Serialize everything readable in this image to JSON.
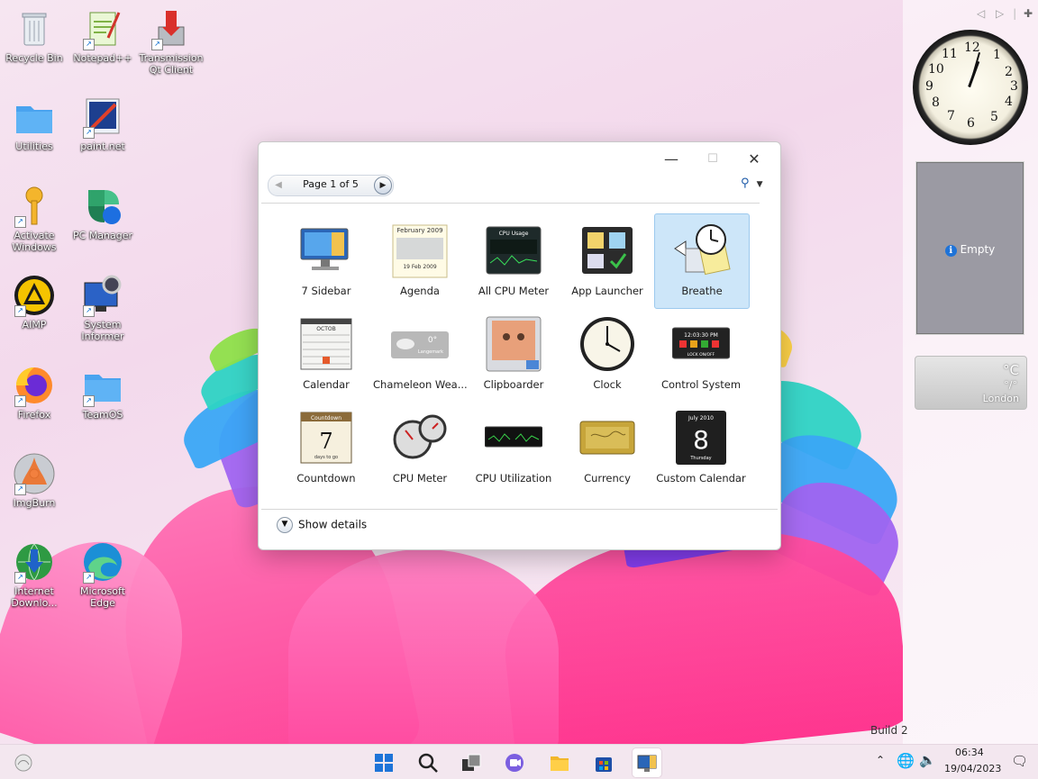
{
  "desktop": {
    "icons": [
      {
        "label": "Recycle Bin",
        "icon": "recycle-bin-icon"
      },
      {
        "label": "Notepad++",
        "icon": "notepad-plus-plus-icon"
      },
      {
        "label": "Transmission Qt Client",
        "icon": "transmission-icon"
      },
      {
        "label": "Utilities",
        "icon": "folder-icon"
      },
      {
        "label": "paint.net",
        "icon": "paint-net-icon"
      },
      {
        "label": "Activate Windows",
        "icon": "key-icon"
      },
      {
        "label": "PC Manager",
        "icon": "pc-manager-icon"
      },
      {
        "label": "AIMP",
        "icon": "aimp-icon"
      },
      {
        "label": "System Informer",
        "icon": "system-informer-icon"
      },
      {
        "label": "Firefox",
        "icon": "firefox-icon"
      },
      {
        "label": "TeamOS",
        "icon": "folder-icon"
      },
      {
        "label": "ImgBurn",
        "icon": "imgburn-icon"
      },
      {
        "label": "Internet Downlo...",
        "icon": "internet-download-manager-icon"
      },
      {
        "label": "Microsoft Edge",
        "icon": "edge-icon"
      }
    ],
    "build_text": "Build 2"
  },
  "gallery": {
    "pager_text": "Page 1 of 5",
    "show_details": "Show details",
    "gadgets": [
      {
        "label": "7 Sidebar"
      },
      {
        "label": "Agenda"
      },
      {
        "label": "All CPU Meter"
      },
      {
        "label": "App Launcher"
      },
      {
        "label": "Breathe",
        "selected": true
      },
      {
        "label": "Calendar"
      },
      {
        "label": "Chameleon Wea..."
      },
      {
        "label": "Clipboarder"
      },
      {
        "label": "Clock"
      },
      {
        "label": "Control System"
      },
      {
        "label": "Countdown"
      },
      {
        "label": "CPU Meter"
      },
      {
        "label": "CPU Utilization"
      },
      {
        "label": "Currency"
      },
      {
        "label": "Custom Calendar"
      }
    ],
    "thumb_text": {
      "agenda_month": "February 2009",
      "agenda_date": "19 Feb 2009",
      "cpu_title": "CPU Usage",
      "cal_month": "OCTOB",
      "chameleon_temp": "0°",
      "chameleon_city": "Langemark",
      "control_time": "12:03:30 PM",
      "control_lock": "LOCK ON/OFF",
      "countdown_title": "Countdown",
      "countdown_num": "7",
      "countdown_sub": "days to go",
      "custom_month": "July 2010",
      "custom_num": "8",
      "custom_day": "Thursday"
    }
  },
  "sidebar": {
    "empty_label": "Empty",
    "weather_unit": "°C",
    "weather_value": "°/°",
    "weather_city": "London",
    "clock_numbers": [
      "12",
      "1",
      "2",
      "3",
      "4",
      "5",
      "6",
      "7",
      "8",
      "9",
      "10",
      "11"
    ]
  },
  "taskbar": {
    "time": "06:34",
    "date": "19/04/2023"
  }
}
